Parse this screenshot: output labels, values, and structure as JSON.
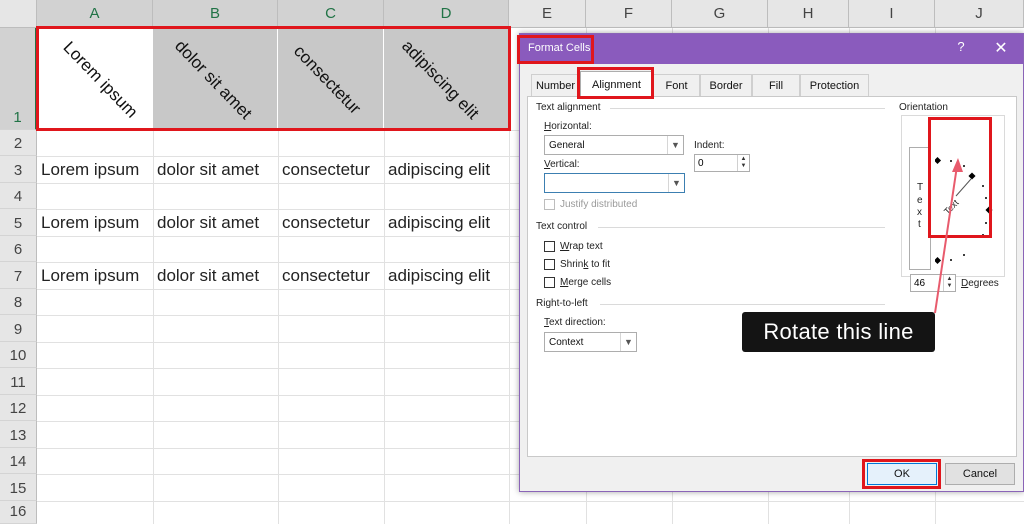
{
  "sheet": {
    "columns": [
      "A",
      "B",
      "C",
      "D",
      "E",
      "F",
      "G",
      "H",
      "I",
      "J"
    ],
    "rows": [
      "1",
      "2",
      "3",
      "4",
      "5",
      "6",
      "7",
      "8",
      "9",
      "10",
      "11",
      "12",
      "13",
      "14",
      "15",
      "16"
    ],
    "header_cells": [
      "Lorem ipsum",
      "dolor sit amet",
      "consectetur",
      "adipiscing elit"
    ],
    "data_rows": [
      [
        "Lorem ipsum",
        "dolor sit amet",
        "consectetur",
        "adipiscing elit"
      ],
      [
        "Lorem ipsum",
        "dolor sit amet",
        "consectetur",
        "adipiscing elit"
      ],
      [
        "Lorem ipsum",
        "dolor sit amet",
        "consectetur",
        "adipiscing elit"
      ]
    ],
    "rotation_degrees": 46,
    "highlight_color": "#e0161c",
    "select_color": "#217346"
  },
  "dialog": {
    "title": "Format Cells",
    "help": "?",
    "close": "✕",
    "title_color": "#8a5bbd",
    "tabs": [
      "Number",
      "Alignment",
      "Font",
      "Border",
      "Fill",
      "Protection"
    ],
    "active_tab": "Alignment",
    "text_alignment": {
      "section": "Text alignment",
      "horizontal_label_u": "H",
      "horizontal_label_rest": "orizontal:",
      "horizontal_value": "General",
      "indent_label": "Indent:",
      "indent_value": "0",
      "vertical_label_u": "V",
      "vertical_label_rest": "ertical:",
      "vertical_value": "",
      "justify_distributed": "Justify distributed"
    },
    "text_control": {
      "section": "Text control",
      "wrap_u": "W",
      "wrap_rest": "rap text",
      "shrink_a": "Shrin",
      "shrink_u": "k",
      "shrink_b": " to fit",
      "merge_u": "M",
      "merge_rest": "erge cells"
    },
    "rtl": {
      "section": "Right-to-left",
      "direction_a": "",
      "direction_u": "T",
      "direction_b": "ext direction:",
      "direction_value": "Context"
    },
    "orientation": {
      "section": "Orientation",
      "vertical_text": [
        "T",
        "e",
        "x",
        "t"
      ],
      "dial_text": "Text",
      "degrees_value": "46",
      "degrees_u": "D",
      "degrees_rest": "egrees"
    },
    "buttons": {
      "ok": "OK",
      "cancel": "Cancel"
    }
  },
  "callout": {
    "text": "Rotate this line"
  },
  "icons": {
    "combo_arrow": "chevron-down-icon",
    "spin": "spin-arrows-icon",
    "close": "close-icon",
    "help": "help-icon"
  }
}
